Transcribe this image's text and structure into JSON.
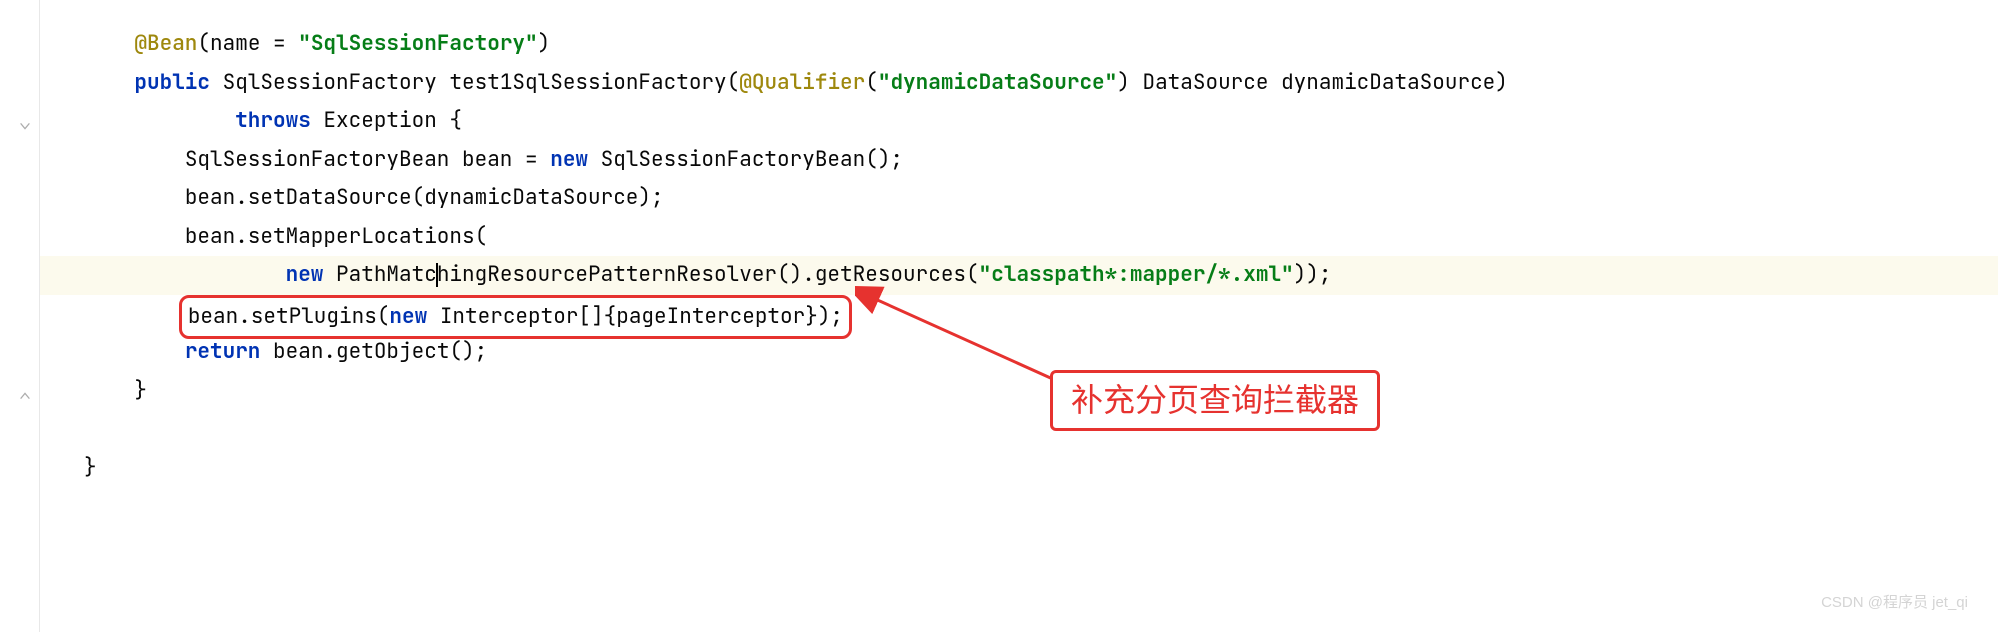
{
  "code": {
    "line1": {
      "indent": "    ",
      "at": "@Bean",
      "paren_open": "(",
      "name_key": "name",
      "equals": " = ",
      "value": "\"SqlSessionFactory\"",
      "paren_close": ")"
    },
    "line2": {
      "indent": "    ",
      "public": "public",
      "sp1": " ",
      "ret_type": "SqlSessionFactory",
      "sp2": " ",
      "method": "test1SqlSessionFactory(",
      "qualifier": "@Qualifier",
      "q_open": "(",
      "q_value": "\"dynamicDataSource\"",
      "q_close": ")",
      "param": " DataSource dynamicDataSource)"
    },
    "line3": {
      "indent": "            ",
      "throws": "throws",
      "sp": " ",
      "exc": "Exception {"
    },
    "line4": {
      "indent": "        ",
      "type1": "SqlSessionFactoryBean bean = ",
      "new": "new",
      "rest": " SqlSessionFactoryBean();"
    },
    "line5": {
      "indent": "        ",
      "text": "bean.setDataSource(dynamicDataSource);"
    },
    "line6": {
      "indent": "        ",
      "text": "bean.setMapperLocations("
    },
    "line7": {
      "indent": "                ",
      "new": "new",
      "part1": " PathMatc",
      "part2": "hingResourcePatternResolver().getResources(",
      "str": "\"classpath*:mapper/*.xml\"",
      "end": "));"
    },
    "line8": {
      "indent": "        ",
      "text1": "bean.setPlugins(",
      "new": "new",
      "text2": " Interceptor[]{pageInterceptor});"
    },
    "line9": {
      "indent": "        ",
      "return": "return",
      "rest": " bean.getObject();"
    },
    "line10": {
      "indent": "    ",
      "brace": "}"
    },
    "line11": {
      "text": ""
    },
    "line12": {
      "brace": "}"
    }
  },
  "annotation": {
    "text": "补充分页查询拦截器"
  },
  "watermark": "CSDN @程序员 jet_qi"
}
